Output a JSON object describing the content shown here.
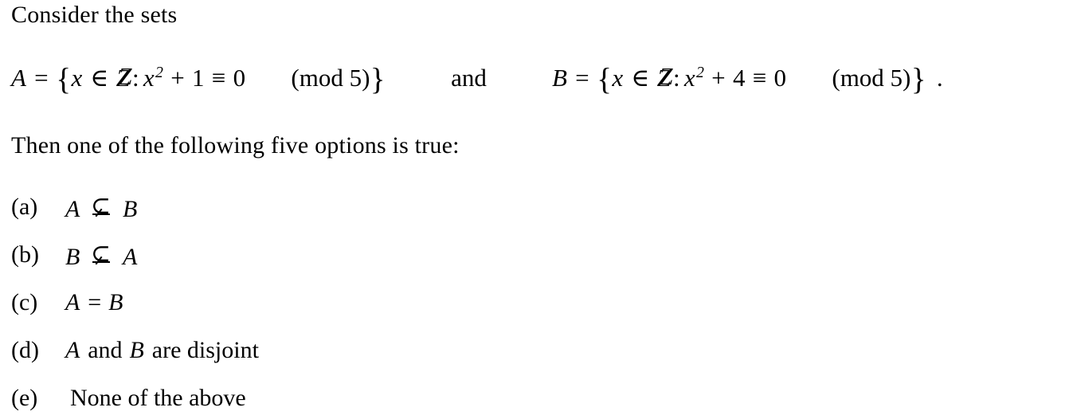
{
  "document": {
    "background_color": "#ffffff",
    "text_color": "#000000",
    "intro_line": "Consider the sets",
    "question_line": "Then one of the following five options is true:"
  },
  "definitions": {
    "set_a": {
      "name": "A",
      "equals": "=",
      "open_brace": "{",
      "variable": "x",
      "member_symbol": "∈",
      "domain": "Z",
      "colon": ":",
      "expression_base": "x",
      "expression_exponent": "2",
      "plus": "+",
      "constant": "1",
      "congruent_symbol": "≡",
      "residue": "0",
      "modulus_text": "(mod 5)",
      "close_brace": "}"
    },
    "conjunction": "and",
    "set_b": {
      "name": "B",
      "equals": "=",
      "open_brace": "{",
      "variable": "x",
      "member_symbol": "∈",
      "domain": "Z",
      "colon": ":",
      "expression_base": "x",
      "expression_exponent": "2",
      "plus": "+",
      "constant": "4",
      "congruent_symbol": "≡",
      "residue": "0",
      "modulus_text": "(mod 5)",
      "close_brace": "}"
    },
    "terminal_period": "."
  },
  "options": [
    {
      "label": "(a)",
      "left": "A",
      "relation": "⊊",
      "relation_name": "subset-not-equal",
      "right": "B"
    },
    {
      "label": "(b)",
      "left": "B",
      "relation": "⊊",
      "relation_name": "subset-not-equal",
      "right": "A"
    },
    {
      "label": "(c)",
      "left": "A",
      "relation": "=",
      "relation_name": "equals",
      "right": "B"
    },
    {
      "label": "(d)",
      "left": "A",
      "middle_text": "and",
      "right": "B",
      "trailing_text": "are disjoint"
    },
    {
      "label": "(e)",
      "text": "None of the above"
    }
  ]
}
